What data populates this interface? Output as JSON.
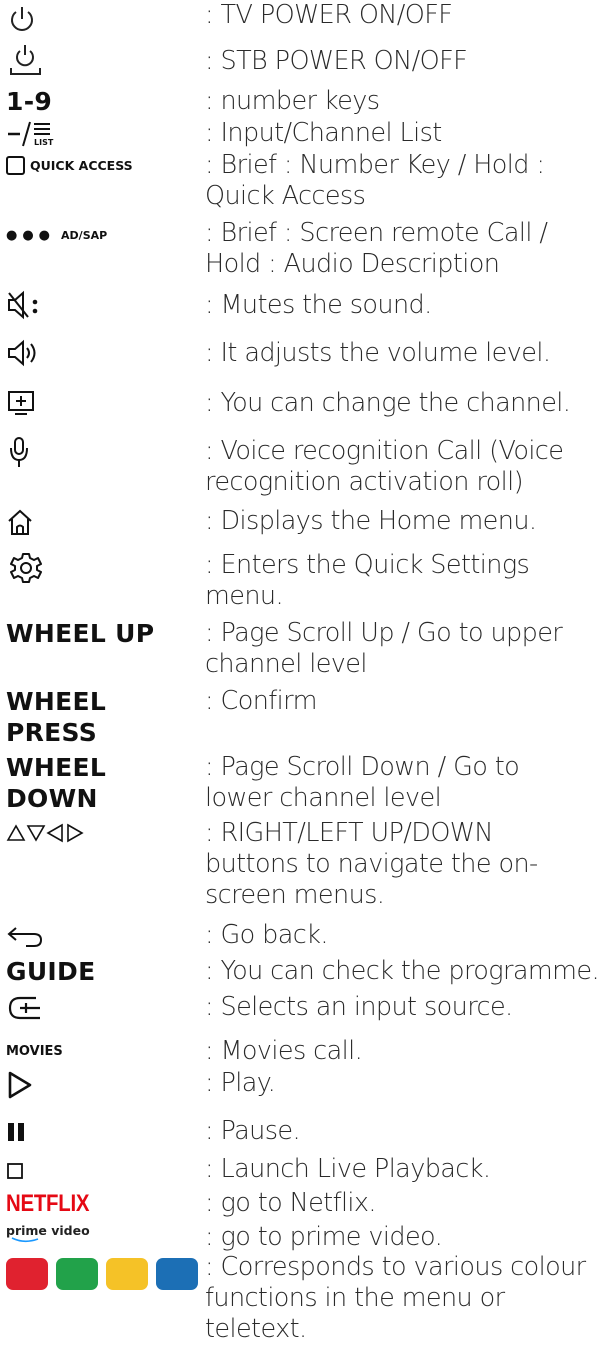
{
  "rows": [
    {
      "key_icon": "tv-power-icon",
      "desc": ": TV POWER ON/OFF"
    },
    {
      "key_icon": "stb-power-icon",
      "desc": ": STB POWER ON/OFF"
    },
    {
      "key_label": "1-9",
      "desc": ": number keys"
    },
    {
      "key_icon": "input-channel-list-icon",
      "key_label": "LIST",
      "desc": ": Input/Channel List"
    },
    {
      "key_icon": "quick-access-icon",
      "key_label": "QUICK ACCESS",
      "desc": ": Brief : Number Key / Hold :\nQuick Access"
    },
    {
      "key_icon": "ad-sap-dots-icon",
      "key_label": "AD/SAP",
      "desc": ": Brief : Screen remote Call /\nHold : Audio Description"
    },
    {
      "key_icon": "mute-icon",
      "desc": ": Mutes the sound."
    },
    {
      "key_icon": "volume-icon",
      "desc": ": It adjusts the volume level."
    },
    {
      "key_icon": "channel-icon",
      "desc": ": You can change the channel."
    },
    {
      "key_icon": "microphone-icon",
      "desc": ": Voice recognition Call (Voice\nrecognition activation roll)"
    },
    {
      "key_icon": "home-icon",
      "desc": ": Displays the Home menu."
    },
    {
      "key_icon": "settings-gear-icon",
      "desc": ": Enters the Quick Settings\nmenu."
    },
    {
      "key_label": "WHEEL UP",
      "desc": ": Page Scroll Up / Go to upper\nchannel level"
    },
    {
      "key_label": "WHEEL\nPRESS",
      "desc": ": Confirm"
    },
    {
      "key_label": "WHEEL\nDOWN",
      "desc": ": Page Scroll Down / Go to\nlower channel level"
    },
    {
      "key_icon": "arrow-keys-icon",
      "desc": ": RIGHT/LEFT UP/DOWN\nbuttons to navigate the on-\nscreen menus."
    },
    {
      "key_icon": "back-arrow-icon",
      "desc": ": Go back."
    },
    {
      "key_label": "GUIDE",
      "desc": ": You can check the programme."
    },
    {
      "key_icon": "input-source-icon",
      "desc": ": Selects an input source."
    },
    {
      "key_label": "MOVIES",
      "desc": ": Movies call."
    },
    {
      "key_icon": "play-icon",
      "desc": ": Play."
    },
    {
      "key_icon": "pause-icon",
      "desc": ": Pause."
    },
    {
      "key_icon": "stop-icon",
      "desc": ": Launch Live Playback."
    },
    {
      "key_label": "NETFLIX",
      "desc": ": go to Netflix."
    },
    {
      "key_label": "prime video",
      "desc": ": go to prime video."
    },
    {
      "key_icon": "color-buttons-icon",
      "desc": ": Corresponds to various colour\nfunctions in the menu or\nteletext."
    }
  ],
  "colors": {
    "netflix_red": "#e50914",
    "red_button": "#e0222f",
    "green_button": "#22a24a",
    "yellow_button": "#f5c227",
    "blue_button": "#1c6fb5",
    "text": "#2a2a2a"
  }
}
